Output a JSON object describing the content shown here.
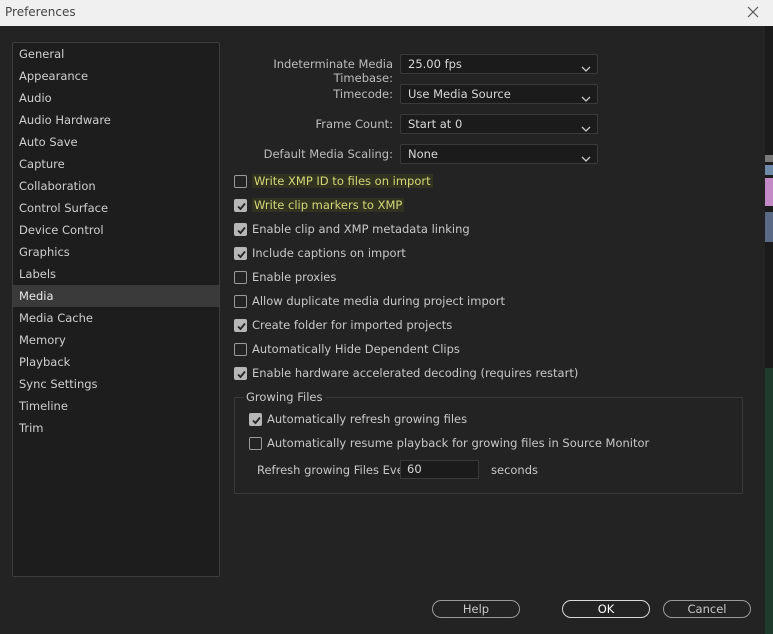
{
  "window": {
    "title": "Preferences",
    "close_icon": "close-icon"
  },
  "sidebar": {
    "selected": "Media",
    "items": [
      {
        "label": "General"
      },
      {
        "label": "Appearance"
      },
      {
        "label": "Audio"
      },
      {
        "label": "Audio Hardware"
      },
      {
        "label": "Auto Save"
      },
      {
        "label": "Capture"
      },
      {
        "label": "Collaboration"
      },
      {
        "label": "Control Surface"
      },
      {
        "label": "Device Control"
      },
      {
        "label": "Graphics"
      },
      {
        "label": "Labels"
      },
      {
        "label": "Media"
      },
      {
        "label": "Media Cache"
      },
      {
        "label": "Memory"
      },
      {
        "label": "Playback"
      },
      {
        "label": "Sync Settings"
      },
      {
        "label": "Timeline"
      },
      {
        "label": "Trim"
      }
    ]
  },
  "settings": {
    "timebase": {
      "label": "Indeterminate Media Timebase:",
      "value": "25.00 fps"
    },
    "timecode": {
      "label": "Timecode:",
      "value": "Use Media Source"
    },
    "frame_count": {
      "label": "Frame Count:",
      "value": "Start at 0"
    },
    "scaling": {
      "label": "Default Media Scaling:",
      "value": "None"
    }
  },
  "options": [
    {
      "label": "Write XMP ID to files on import",
      "checked": false,
      "highlighted": true
    },
    {
      "label": "Write clip markers to XMP",
      "checked": true,
      "highlighted": true
    },
    {
      "label": "Enable clip and XMP metadata linking",
      "checked": true
    },
    {
      "label": "Include captions on import",
      "checked": true
    },
    {
      "label": "Enable proxies",
      "checked": false
    },
    {
      "label": "Allow duplicate media during project import",
      "checked": false
    },
    {
      "label": "Create folder for imported projects",
      "checked": true
    },
    {
      "label": "Automatically Hide Dependent Clips",
      "checked": false
    },
    {
      "label": "Enable hardware accelerated decoding (requires restart)",
      "checked": true
    }
  ],
  "growing_files": {
    "title": "Growing Files",
    "options": [
      {
        "label": "Automatically refresh growing files",
        "checked": true
      },
      {
        "label": "Automatically resume playback for growing files in Source Monitor",
        "checked": false
      }
    ],
    "refresh_label": "Refresh growing Files Every",
    "refresh_value": "60",
    "refresh_unit": "seconds"
  },
  "buttons": {
    "help": "Help",
    "ok": "OK",
    "cancel": "Cancel"
  },
  "colors": {
    "background": "#232323",
    "highlight_text": "#d4d87a",
    "selected_item": "#3a3a3a"
  }
}
